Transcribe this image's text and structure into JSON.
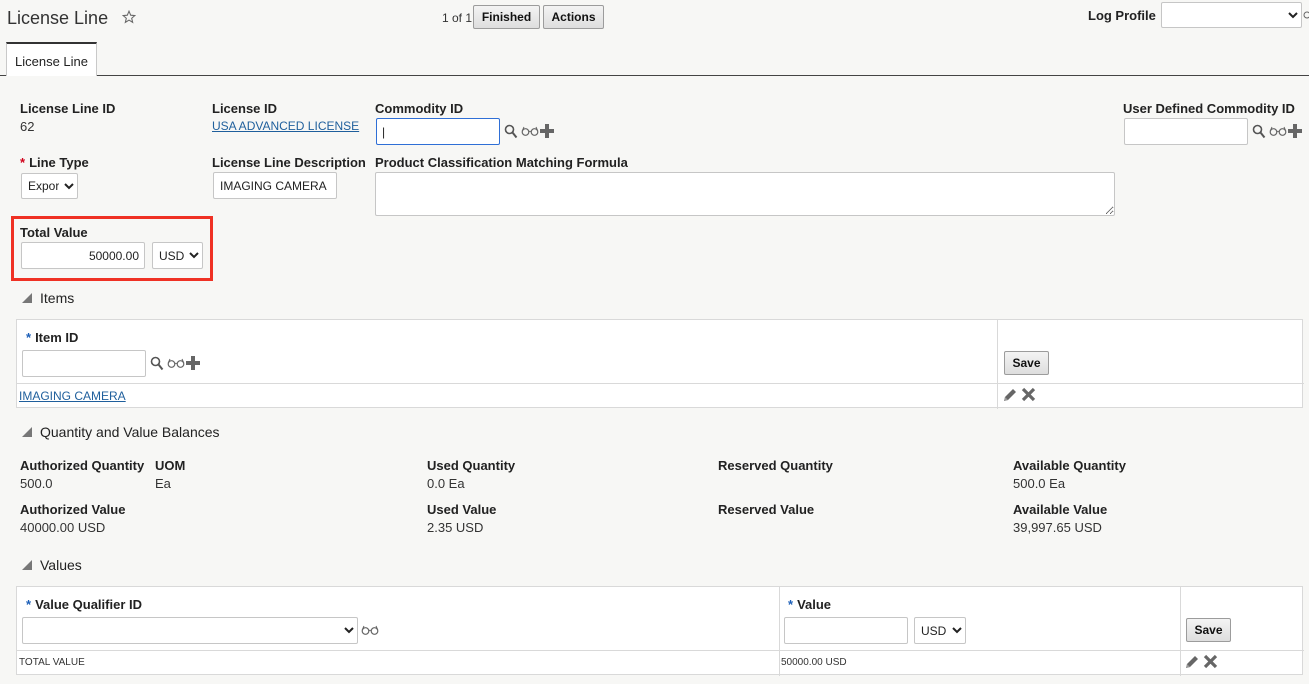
{
  "header": {
    "title": "License Line",
    "pager": "1 of 1",
    "finished_label": "Finished",
    "actions_label": "Actions",
    "log_profile_label": "Log Profile",
    "log_profile_value": ""
  },
  "tabs": [
    {
      "label": "License Line"
    }
  ],
  "form": {
    "license_line_id_label": "License Line ID",
    "license_line_id_value": "62",
    "license_id_label": "License ID",
    "license_id_value": "USA ADVANCED LICENSE",
    "commodity_id_label": "Commodity ID",
    "commodity_id_value": "|",
    "user_defined_commodity_label": "User Defined Commodity ID",
    "user_defined_commodity_value": "",
    "line_type_label": "Line Type",
    "line_type_value": "Export",
    "description_label": "License Line Description",
    "description_value": "IMAGING CAMERA",
    "formula_label": "Product Classification Matching Formula",
    "formula_value": "",
    "total_value_label": "Total Value",
    "total_value_value": "50000.00",
    "total_value_currency": "USD"
  },
  "items": {
    "section_title": "Items",
    "item_id_label": "Item ID",
    "item_id_value": "",
    "save_label": "Save",
    "rows": [
      {
        "item": "IMAGING CAMERA"
      }
    ]
  },
  "balances": {
    "section_title": "Quantity and Value Balances",
    "authorized_quantity_label": "Authorized Quantity",
    "authorized_quantity_value": "500.0",
    "uom_label": "UOM",
    "uom_value": "Ea",
    "used_quantity_label": "Used Quantity",
    "used_quantity_value": "0.0 Ea",
    "reserved_quantity_label": "Reserved Quantity",
    "available_quantity_label": "Available Quantity",
    "available_quantity_value": "500.0 Ea",
    "authorized_value_label": "Authorized Value",
    "authorized_value_value": "40000.00 USD",
    "used_value_label": "Used Value",
    "used_value_value": "2.35 USD",
    "reserved_value_label": "Reserved Value",
    "available_value_label": "Available Value",
    "available_value_value": "39,997.65 USD"
  },
  "values": {
    "section_title": "Values",
    "qualifier_label": "Value Qualifier ID",
    "qualifier_value": "",
    "value_label": "Value",
    "value_value": "",
    "currency": "USD",
    "save_label": "Save",
    "rows": [
      {
        "qualifier": "TOTAL VALUE",
        "value": "50000.00 USD"
      }
    ]
  },
  "colors": {
    "highlight": "#ef3124",
    "link": "#1f5f9c",
    "required_red": "#d0021b",
    "required_blue": "#1c5fb8"
  },
  "icons": [
    "star-icon",
    "search-icon",
    "glasses-icon",
    "plus-icon",
    "triangle-icon",
    "pencil-icon",
    "close-icon"
  ]
}
